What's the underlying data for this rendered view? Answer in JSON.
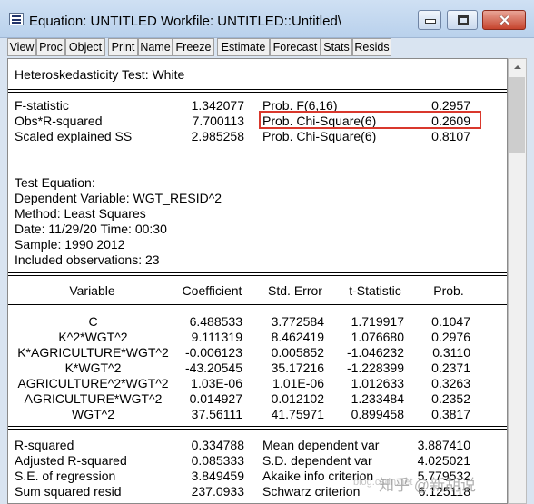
{
  "window": {
    "title": "Equation: UNTITLED   Workfile: UNTITLED::Untitled\\",
    "minimize_label": "minimize",
    "maximize_label": "maximize",
    "close_label": "✕"
  },
  "toolbar": [
    "View",
    "Proc",
    "Object",
    "Print",
    "Name",
    "Freeze",
    "Estimate",
    "Forecast",
    "Stats",
    "Resids"
  ],
  "heading": "Heteroskedasticity Test: White",
  "test_stats": [
    {
      "label": "F-statistic",
      "value": "1.342077",
      "prob_label": "Prob. F(6,16)",
      "prob": "0.2957"
    },
    {
      "label": "Obs*R-squared",
      "value": "7.700113",
      "prob_label": "Prob. Chi-Square(6)",
      "prob": "0.2609"
    },
    {
      "label": "Scaled explained SS",
      "value": "2.985258",
      "prob_label": "Prob. Chi-Square(6)",
      "prob": "0.8107"
    }
  ],
  "test_equation": {
    "title": "Test Equation:",
    "dependent": "Dependent Variable: WGT_RESID^2",
    "method": "Method: Least Squares",
    "date": "Date: 11/29/20   Time: 00:30",
    "sample": "Sample: 1990 2012",
    "observations": "Included observations: 23"
  },
  "coef_headers": [
    "Variable",
    "Coefficient",
    "Std. Error",
    "t-Statistic",
    "Prob."
  ],
  "coef_rows": [
    [
      "C",
      "6.488533",
      "3.772584",
      "1.719917",
      "0.1047"
    ],
    [
      "K^2*WGT^2",
      "9.111319",
      "8.462419",
      "1.076680",
      "0.2976"
    ],
    [
      "K*AGRICULTURE*WGT^2",
      "-0.006123",
      "0.005852",
      "-1.046232",
      "0.3110"
    ],
    [
      "K*WGT^2",
      "-43.20545",
      "35.17216",
      "-1.228399",
      "0.2371"
    ],
    [
      "AGRICULTURE^2*WGT^2",
      "1.03E-06",
      "1.01E-06",
      "1.012633",
      "0.3263"
    ],
    [
      "AGRICULTURE*WGT^2",
      "0.014927",
      "0.012102",
      "1.233484",
      "0.2352"
    ],
    [
      "WGT^2",
      "37.56111",
      "41.75971",
      "0.899458",
      "0.3817"
    ]
  ],
  "summary_stats": [
    [
      "R-squared",
      "0.334788",
      "Mean dependent var",
      "3.887410"
    ],
    [
      "Adjusted R-squared",
      "0.085333",
      "S.D. dependent var",
      "4.025021"
    ],
    [
      "S.E. of regression",
      "3.849459",
      "Akaike info criterion",
      "5.779532"
    ],
    [
      "Sum squared resid",
      "237.0933",
      "Schwarz criterion",
      "6.125118"
    ]
  ],
  "watermark": "知乎 @新胡说",
  "watermark_small": "blog.csdn.net",
  "colors": {
    "highlight": "#d9382c",
    "titlebar": "#c4d8ef"
  }
}
